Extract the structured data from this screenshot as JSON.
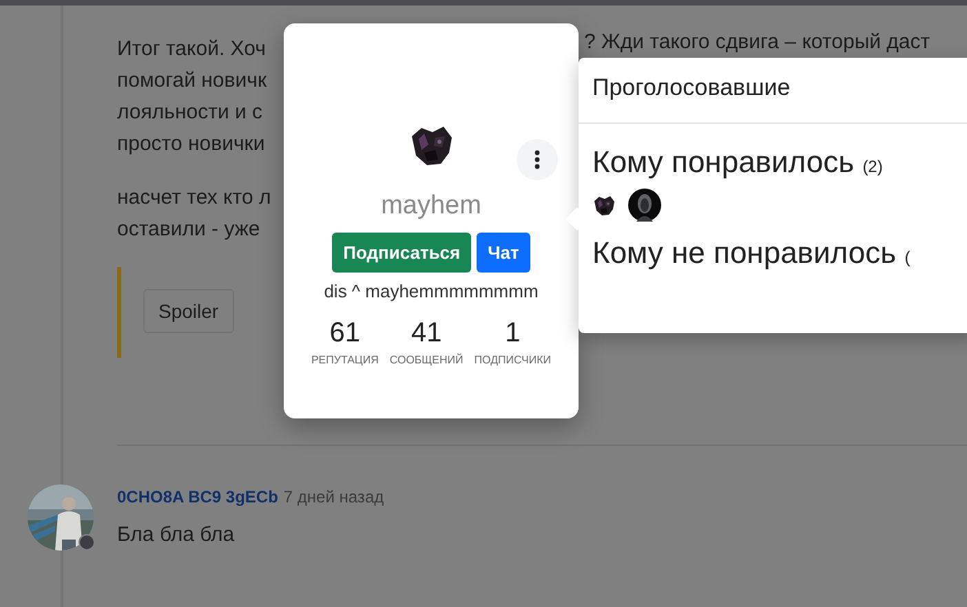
{
  "post": {
    "cut_fragment": "? Жди такого сдвига – который даст",
    "paragraphs": [
      {
        "lines": [
          "Итог такой. Хоч",
          "помогай новичк",
          "лояльности и с",
          "просто новички"
        ]
      },
      {
        "lines": [
          "насчет тех кто л",
          "оставили - уже"
        ]
      }
    ],
    "spoiler": {
      "label": "Spoiler"
    }
  },
  "comment": {
    "author": "0CHO8A BC9 3gECb",
    "time": "7 дней назад",
    "text": "Бла бла бла",
    "online": false
  },
  "profile_card": {
    "name": "mayhem",
    "buttons": [
      {
        "label": "Подписаться",
        "kind": "success"
      },
      {
        "label": "Чат",
        "kind": "primary"
      }
    ],
    "status": "dis ^ mayhemmmmmmmm",
    "stats": [
      {
        "value": "61",
        "label": "РЕПУТАЦИЯ"
      },
      {
        "value": "41",
        "label": "СООБЩЕНИЙ"
      },
      {
        "value": "1",
        "label": "ПОДПИСЧИКИ"
      }
    ]
  },
  "votes": {
    "title": "Проголосовавшие",
    "groups": [
      {
        "label": "Кому понравилось",
        "count": "(2)",
        "voters": [
          {
            "kind": "creature"
          },
          {
            "kind": "dark"
          }
        ]
      },
      {
        "label": "Кому не понравилось",
        "count": "("
      }
    ]
  }
}
